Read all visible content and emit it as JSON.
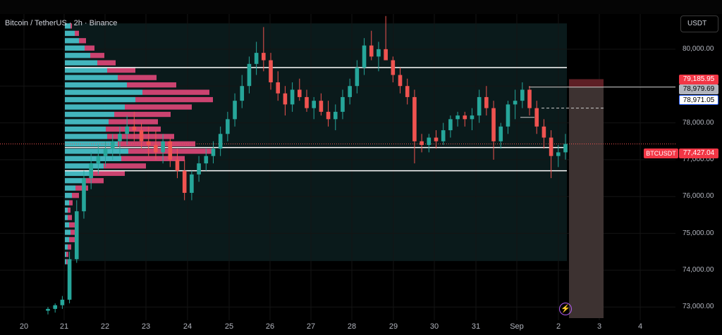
{
  "symbol_title": "Bitcoin / TetherUS · 2h · Binance",
  "currency_button": "USDT",
  "colors": {
    "up": "#26a69a",
    "down": "#ef5350",
    "vp_up": "#49c7cf",
    "vp_down": "#e0487a",
    "line": "#ffffff"
  },
  "price_axis": {
    "ticks": [
      "80,000.00",
      "78,000.00",
      "77,000.00",
      "76,000.00",
      "75,000.00",
      "74,000.00",
      "73,000.00"
    ],
    "tags": [
      {
        "label": "79,185.95",
        "style": "red"
      },
      {
        "label": "78,979.69",
        "style": "grey"
      },
      {
        "label": "78,971.05",
        "style": "outline"
      },
      {
        "label": "77,427.04",
        "style": "red"
      }
    ],
    "symbol_tag": "BTCUSDT"
  },
  "time_axis": [
    "20",
    "21",
    "22",
    "23",
    "24",
    "25",
    "26",
    "27",
    "28",
    "29",
    "30",
    "31",
    "Sep",
    "2",
    "3",
    "4"
  ],
  "chart_data": {
    "type": "candlestick",
    "ylim": [
      72700,
      80800
    ],
    "current_price": 77427.04,
    "hlines": [
      79500,
      77330,
      76700
    ],
    "value_area": [
      74250,
      80700
    ],
    "sl_zone": {
      "top": 79185.95,
      "entry": 78971.05,
      "bottom": 72700
    },
    "candles": [
      [
        72900,
        73000,
        72800,
        72950
      ],
      [
        72950,
        73100,
        72850,
        73050
      ],
      [
        73050,
        73300,
        72950,
        73200
      ],
      [
        73200,
        74500,
        73100,
        74300
      ],
      [
        74300,
        75900,
        74200,
        75600
      ],
      [
        75600,
        76700,
        75400,
        76500
      ],
      [
        76500,
        77200,
        76200,
        76900
      ],
      [
        76900,
        77400,
        76600,
        77100
      ],
      [
        77100,
        77500,
        76800,
        77300
      ],
      [
        77300,
        77700,
        77000,
        77500
      ],
      [
        77500,
        77900,
        77100,
        77700
      ],
      [
        77700,
        78200,
        77400,
        77900
      ],
      [
        77900,
        78300,
        77500,
        77800
      ],
      [
        77800,
        78000,
        77300,
        77500
      ],
      [
        77500,
        77900,
        77100,
        77400
      ],
      [
        77400,
        77800,
        77000,
        77200
      ],
      [
        77200,
        77700,
        76900,
        77500
      ],
      [
        77500,
        77600,
        76800,
        77000
      ],
      [
        77000,
        77300,
        76500,
        76700
      ],
      [
        76700,
        77000,
        75900,
        76100
      ],
      [
        76100,
        76700,
        75900,
        76600
      ],
      [
        76600,
        77100,
        76400,
        76900
      ],
      [
        76900,
        77300,
        76700,
        77100
      ],
      [
        77100,
        77500,
        76900,
        77300
      ],
      [
        77300,
        77900,
        77100,
        77700
      ],
      [
        77700,
        78300,
        77500,
        78100
      ],
      [
        78100,
        78800,
        77900,
        78600
      ],
      [
        78600,
        79300,
        78400,
        79000
      ],
      [
        79000,
        79800,
        78800,
        79600
      ],
      [
        79600,
        80200,
        79300,
        79900
      ],
      [
        79900,
        80600,
        79400,
        79700
      ],
      [
        79700,
        79900,
        78900,
        79100
      ],
      [
        79100,
        79400,
        78600,
        78800
      ],
      [
        78800,
        79000,
        78200,
        78500
      ],
      [
        78500,
        79100,
        78300,
        78900
      ],
      [
        78900,
        79200,
        78600,
        78700
      ],
      [
        78700,
        78900,
        78300,
        78400
      ],
      [
        78400,
        78700,
        78100,
        78600
      ],
      [
        78600,
        78800,
        78200,
        78300
      ],
      [
        78300,
        78600,
        77900,
        78100
      ],
      [
        78100,
        78500,
        77800,
        78300
      ],
      [
        78300,
        78900,
        78100,
        78700
      ],
      [
        78700,
        79200,
        78500,
        79000
      ],
      [
        79000,
        79700,
        78800,
        79500
      ],
      [
        79500,
        80300,
        79300,
        80100
      ],
      [
        80100,
        80500,
        79700,
        79800
      ],
      [
        79800,
        80200,
        79400,
        80000
      ],
      [
        80000,
        80900,
        79800,
        79700
      ],
      [
        79700,
        79800,
        79100,
        79300
      ],
      [
        79300,
        79500,
        78800,
        79000
      ],
      [
        79000,
        79200,
        78500,
        78700
      ],
      [
        78700,
        78900,
        76900,
        77500
      ],
      [
        77500,
        77700,
        77200,
        77400
      ],
      [
        77400,
        77700,
        77200,
        77600
      ],
      [
        77600,
        77800,
        77300,
        77500
      ],
      [
        77500,
        78000,
        77400,
        77800
      ],
      [
        77800,
        78200,
        77600,
        78100
      ],
      [
        78100,
        78300,
        77900,
        78200
      ],
      [
        78200,
        78300,
        77900,
        78100
      ],
      [
        78100,
        78400,
        77800,
        78200
      ],
      [
        78200,
        78900,
        78000,
        78700
      ],
      [
        78700,
        79000,
        78200,
        78400
      ],
      [
        78400,
        78600,
        77000,
        77500
      ],
      [
        77500,
        78000,
        77300,
        77900
      ],
      [
        77900,
        78600,
        77700,
        78500
      ],
      [
        78500,
        78900,
        78100,
        78600
      ],
      [
        78600,
        79100,
        78400,
        78900
      ],
      [
        78900,
        79000,
        78200,
        78400
      ],
      [
        78400,
        78600,
        77700,
        77900
      ],
      [
        77900,
        78100,
        77300,
        77600
      ],
      [
        77600,
        77800,
        76500,
        77100
      ],
      [
        77100,
        77400,
        76800,
        77200
      ],
      [
        77200,
        77700,
        77000,
        77427
      ]
    ],
    "volume_profile": [
      [
        80700,
        8,
        2
      ],
      [
        80500,
        14,
        6
      ],
      [
        80300,
        20,
        10
      ],
      [
        80100,
        28,
        14
      ],
      [
        79900,
        36,
        20
      ],
      [
        79700,
        46,
        26
      ],
      [
        79500,
        60,
        40
      ],
      [
        79300,
        75,
        55
      ],
      [
        79100,
        88,
        70
      ],
      [
        78900,
        110,
        95
      ],
      [
        78700,
        100,
        110
      ],
      [
        78500,
        85,
        95
      ],
      [
        78300,
        70,
        80
      ],
      [
        78100,
        62,
        70
      ],
      [
        77900,
        58,
        78
      ],
      [
        77700,
        60,
        95
      ],
      [
        77500,
        75,
        110
      ],
      [
        77300,
        90,
        120
      ],
      [
        77100,
        80,
        90
      ],
      [
        76900,
        55,
        60
      ],
      [
        76700,
        40,
        45
      ],
      [
        76500,
        25,
        30
      ],
      [
        76300,
        15,
        18
      ],
      [
        76100,
        10,
        10
      ],
      [
        75900,
        6,
        5
      ],
      [
        75700,
        4,
        4
      ],
      [
        75500,
        4,
        6
      ],
      [
        75300,
        6,
        8
      ],
      [
        75100,
        8,
        10
      ],
      [
        74900,
        6,
        8
      ],
      [
        74700,
        4,
        5
      ],
      [
        74500,
        2,
        3
      ],
      [
        74300,
        2,
        2
      ]
    ]
  }
}
